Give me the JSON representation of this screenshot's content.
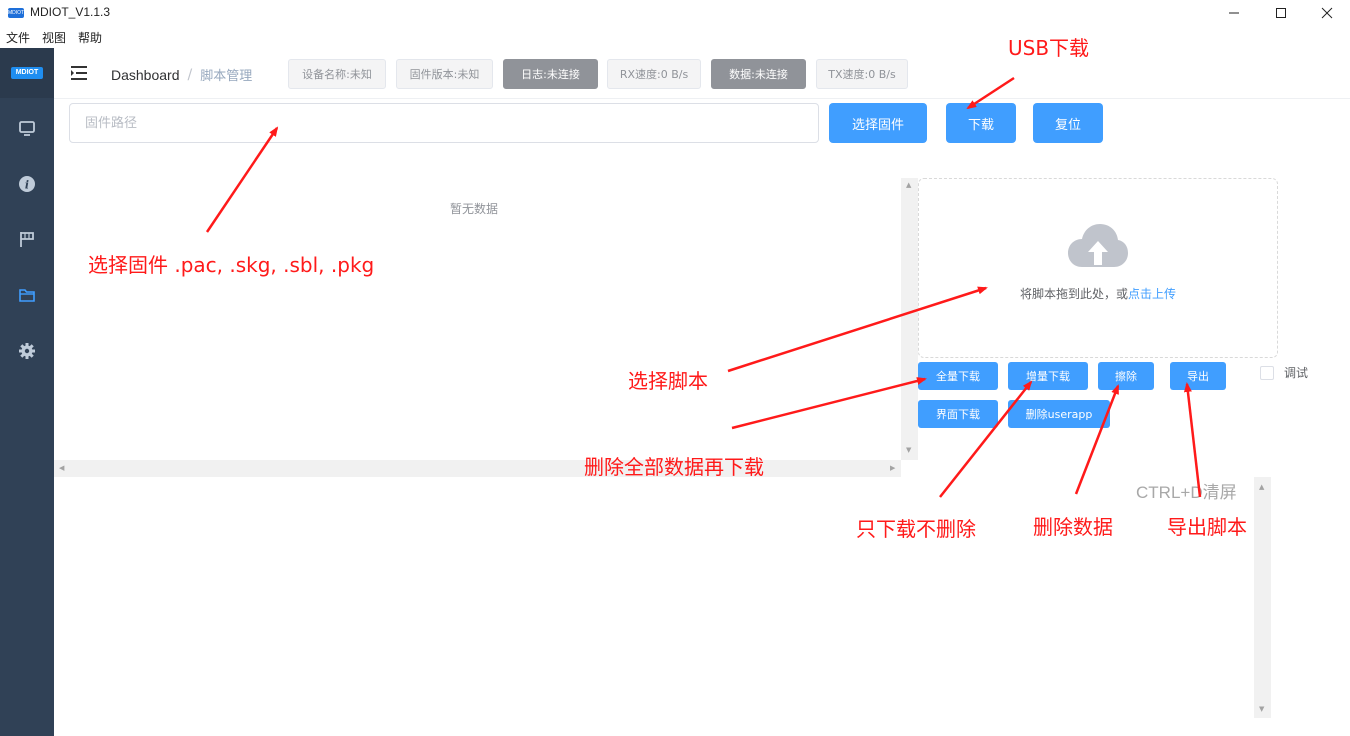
{
  "window": {
    "app_icon_text": "MDIOT",
    "title": "MDIOT_V1.1.3",
    "controls": {
      "minimize": "minimize-icon",
      "maximize": "maximize-icon",
      "close": "close-icon"
    }
  },
  "menu": {
    "items": [
      "文件",
      "视图",
      "帮助"
    ]
  },
  "sidebar": {
    "logo": "MDIOT",
    "items": [
      {
        "icon": "monitor-icon"
      },
      {
        "icon": "info-icon"
      },
      {
        "icon": "flag-icon"
      },
      {
        "icon": "folder-icon",
        "active": true
      },
      {
        "icon": "gear-icon"
      }
    ],
    "active_color": "#409eff"
  },
  "header": {
    "breadcrumb": {
      "home": "Dashboard",
      "separator": "/",
      "current": "脚本管理"
    },
    "status": {
      "device_name": "设备名称:未知",
      "firmware_version": "固件版本:未知",
      "log": "日志:未连接",
      "rx_speed": "RX速度:0 B/s",
      "data": "数据:未连接",
      "tx_speed": "TX速度:0 B/s"
    }
  },
  "firmware": {
    "path_placeholder": "固件路径",
    "select_label": "选择固件",
    "download_label": "下载",
    "reset_label": "复位"
  },
  "table": {
    "empty_text": "暂无数据"
  },
  "upload": {
    "icon": "cloud-upload-icon",
    "text": "将脚本拖到此处，或",
    "link_text": "点击上传"
  },
  "actions": {
    "full_download": "全量下载",
    "incremental_download": "增量下载",
    "erase": "擦除",
    "export": "导出",
    "ui_download": "界面下载",
    "delete_userapp": "删除userapp"
  },
  "debug": {
    "label": "调试",
    "checked": false
  },
  "log": {
    "hint": "CTRL+D清屏"
  },
  "annotations": {
    "color": "#ff1a1a",
    "usb_download": "USB下载",
    "select_firmware": "选择固件 .pac, .skg, .sbl, .pkg",
    "select_script": "选择脚本",
    "delete_all": "删除全部数据再下载",
    "only_download": "只下载不删除",
    "delete_data": "删除数据",
    "export_script": "导出脚本"
  },
  "colors": {
    "primary": "#409eff",
    "sidebar_bg": "#304156",
    "status_dark": "#909399"
  }
}
